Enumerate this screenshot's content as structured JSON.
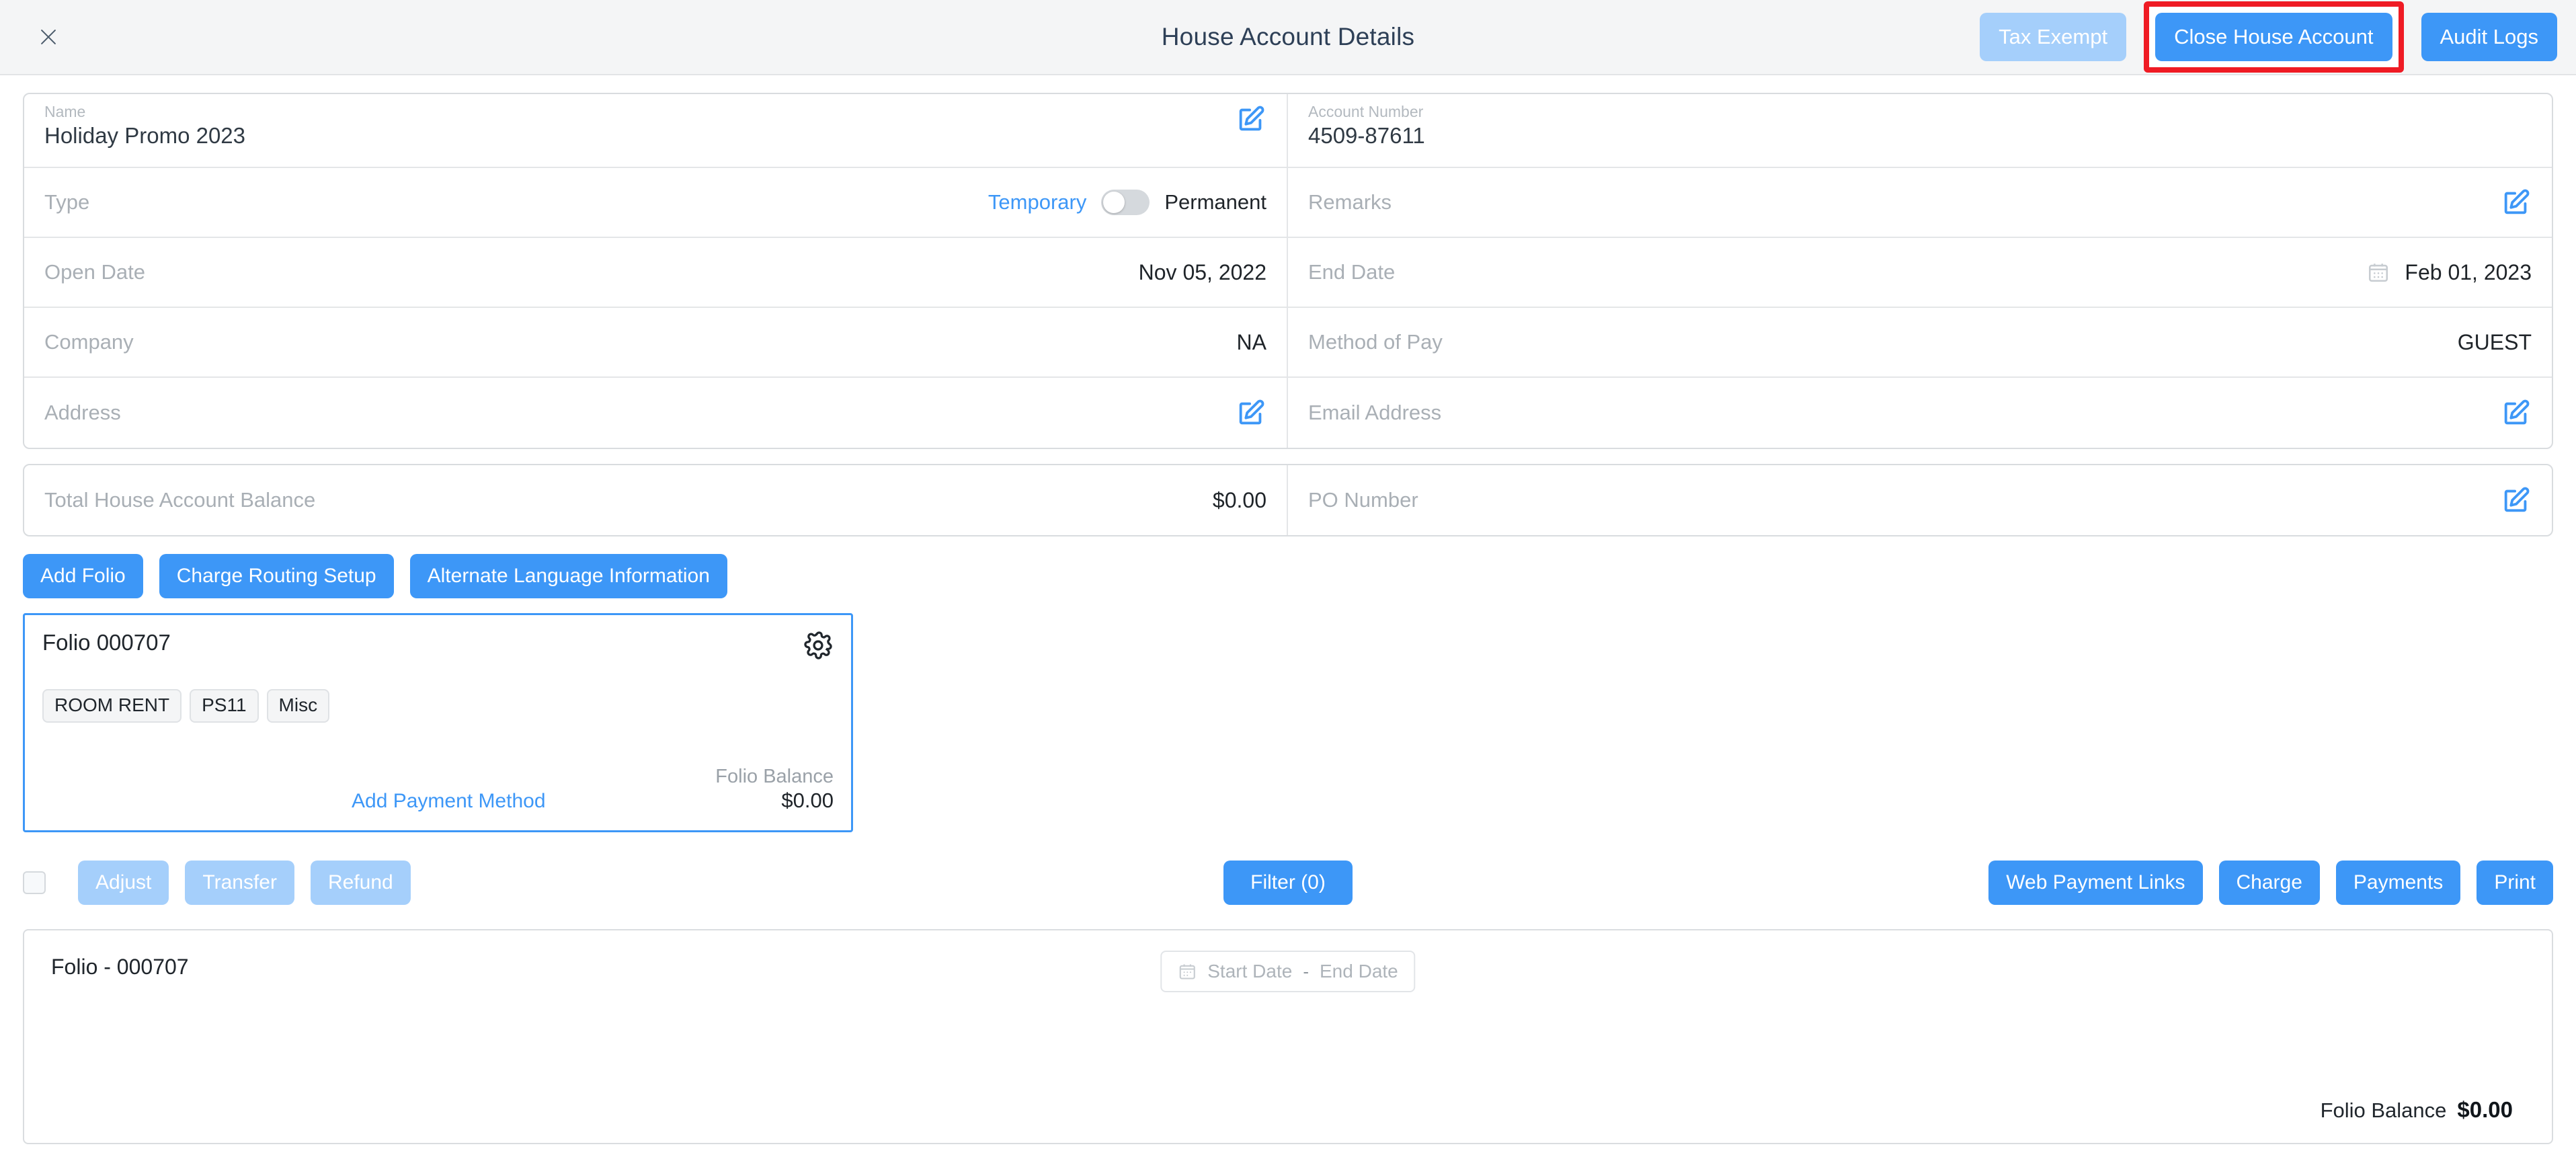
{
  "header": {
    "title": "House Account Details",
    "close_icon": "close-icon",
    "buttons": {
      "tax_exempt": "Tax Exempt",
      "close_house_account": "Close House Account",
      "audit_logs": "Audit Logs"
    },
    "highlight_color": "#ef1b24"
  },
  "details": {
    "name": {
      "label": "Name",
      "value": "Holiday Promo 2023",
      "edit_icon": "edit-icon"
    },
    "account_number": {
      "label": "Account Number",
      "value": "4509-87611"
    },
    "type": {
      "label": "Type",
      "option_left": "Temporary",
      "option_right": "Permanent",
      "selected": "Temporary"
    },
    "remarks": {
      "label": "Remarks",
      "value": "",
      "edit_icon": "edit-icon"
    },
    "open_date": {
      "label": "Open Date",
      "value": "Nov 05, 2022"
    },
    "end_date": {
      "label": "End Date",
      "value": "Feb 01, 2023",
      "calendar_icon": "calendar-icon"
    },
    "company": {
      "label": "Company",
      "value": "NA"
    },
    "method_of_pay": {
      "label": "Method of Pay",
      "value": "GUEST"
    },
    "address": {
      "label": "Address",
      "value": "",
      "edit_icon": "edit-icon"
    },
    "email_address": {
      "label": "Email Address",
      "value": "",
      "edit_icon": "edit-icon"
    },
    "total_balance": {
      "label": "Total House Account Balance",
      "value": "$0.00"
    },
    "po_number": {
      "label": "PO Number",
      "value": "",
      "edit_icon": "edit-icon"
    }
  },
  "folio_actions": {
    "add_folio": "Add Folio",
    "charge_routing_setup": "Charge Routing Setup",
    "alternate_language_information": "Alternate Language Information"
  },
  "folio_card": {
    "title": "Folio 000707",
    "settings_icon": "gear-icon",
    "tags": [
      "ROOM RENT",
      "PS11",
      "Misc"
    ],
    "add_payment_method": "Add Payment Method",
    "balance_label": "Folio Balance",
    "balance_value": "$0.00"
  },
  "toolbar": {
    "adjust": "Adjust",
    "transfer": "Transfer",
    "refund": "Refund",
    "filter": "Filter (0)",
    "web_payment_links": "Web Payment Links",
    "charge": "Charge",
    "payments": "Payments",
    "print": "Print"
  },
  "bottom_panel": {
    "title": "Folio - 000707",
    "start_date_placeholder": "Start Date",
    "end_date_placeholder": "End Date",
    "range_separator": "-",
    "calendar_icon": "calendar-icon",
    "balance_label": "Folio Balance",
    "balance_value": "$0.00"
  }
}
